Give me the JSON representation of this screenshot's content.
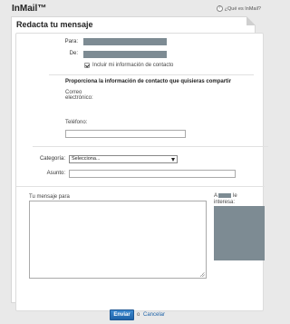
{
  "header": {
    "brand": "InMail™",
    "help_icon": "?",
    "help_label": "¿Qué es InMail?"
  },
  "card": {
    "title": "Redacta tu mensaje"
  },
  "form": {
    "to_label": "Para:",
    "from_label": "De:",
    "include_contact_label": "Incluir mi información de contacto",
    "include_contact_checked": true,
    "contact_heading": "Proporciona la información de contacto que quisieras compartir",
    "email_label_line1": "Correo",
    "email_label_line2": "electrónico:",
    "phone_label": "Teléfono:",
    "phone_value": "",
    "category_label": "Categoría:",
    "category_selected": "Selecciona...",
    "subject_label": "Asunto:",
    "subject_value": "",
    "message_label": "Tu mensaje para",
    "message_value": "",
    "sidebar_prefix": "A",
    "sidebar_suffix": "le",
    "sidebar_line2": "interesa:"
  },
  "footer": {
    "send_label": "Enviar",
    "or_label": "o",
    "cancel_label": "Cancelar"
  },
  "colors": {
    "redaction": "#7d8b93",
    "button": "#1f63a8",
    "link": "#1f63a8"
  }
}
